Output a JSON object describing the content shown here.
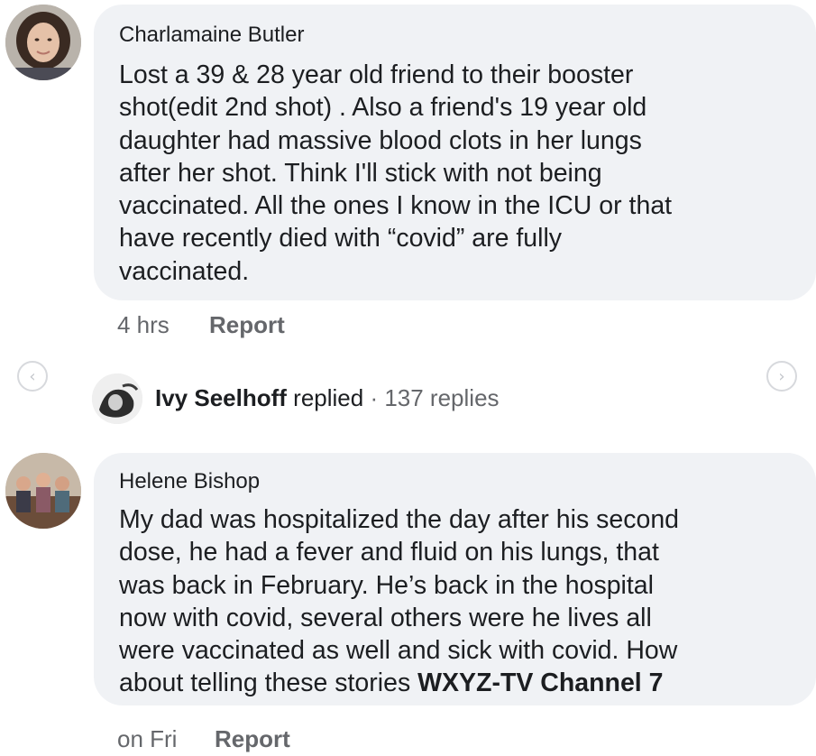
{
  "comments": [
    {
      "author": "Charlamaine Butler",
      "text": "Lost a 39 & 28 year old friend to their booster\nshot(edit 2nd shot) . Also a friend's 19 year old\ndaughter had massive blood clots in her lungs\nafter her shot. Think I'll stick with not being\nvaccinated. All the ones I know in the ICU or that\nhave recently died with “covid” are fully\nvaccinated.",
      "time": "4 hrs",
      "report_label": "Report"
    },
    {
      "author": "Helene Bishop",
      "text": "My dad was hospitalized the day after his second\ndose, he had a fever and fluid on his lungs, that\nwas back in February. He’s back in the hospital\nnow with covid, several others were he lives all\nwere vaccinated as well and sick with covid. How\nabout telling these stories ",
      "tag": "WXYZ-TV Channel 7",
      "time": "on Fri",
      "report_label": "Report"
    }
  ],
  "reply_summary": {
    "name": "Ivy Seelhoff",
    "action": " replied",
    "separator": " · ",
    "count": "137 replies"
  },
  "nav": {
    "prev_icon": "chevron-left-icon",
    "next_icon": "chevron-right-icon"
  },
  "colors": {
    "bubble": "#f0f2f5",
    "meta_text": "#65676b",
    "body_text": "#1c1e21"
  }
}
